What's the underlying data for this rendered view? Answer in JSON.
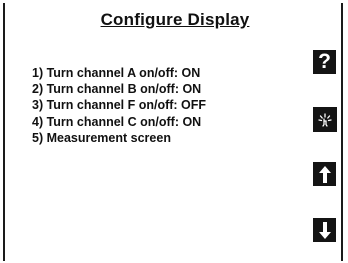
{
  "screen": {
    "title": "Configure Display",
    "menu_items": [
      "1) Turn channel A on/off: ON",
      "2) Turn channel B on/off: ON",
      "3) Turn channel F on/off: OFF",
      "4) Turn channel C on/off: ON",
      "5) Measurement screen"
    ]
  },
  "softkeys": [
    {
      "icon": "question-mark-icon",
      "label": "?"
    },
    {
      "icon": "touch-select-icon"
    },
    {
      "icon": "arrow-up-icon"
    },
    {
      "icon": "arrow-down-icon"
    }
  ],
  "colors": {
    "key_background": "#141414",
    "text": "#111111",
    "background": "#ffffff"
  }
}
